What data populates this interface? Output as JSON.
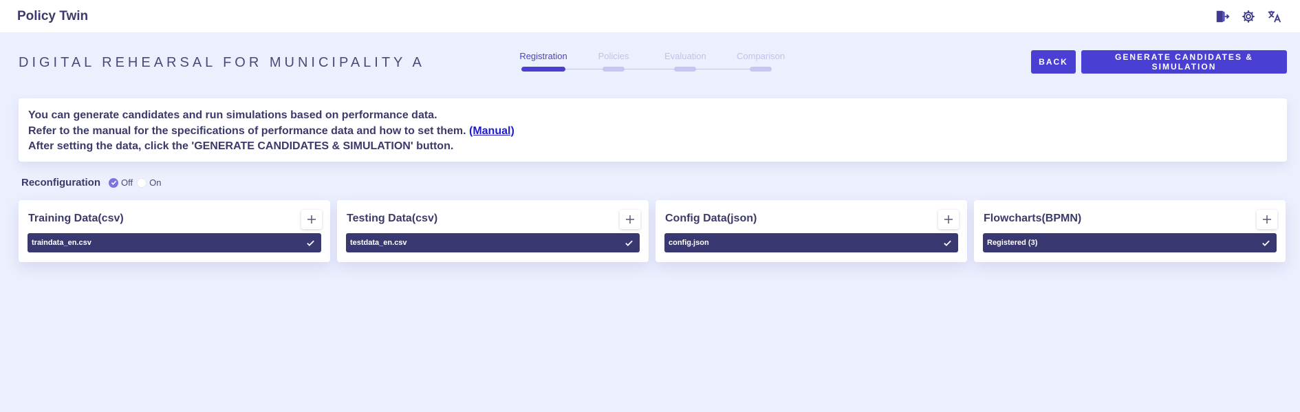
{
  "app": {
    "title": "Policy Twin"
  },
  "top_icons": [
    {
      "name": "logout-icon"
    },
    {
      "name": "gear-icon"
    },
    {
      "name": "translate-icon"
    }
  ],
  "page": {
    "title": "DIGITAL REHEARSAL FOR MUNICIPALITY A"
  },
  "stepper": {
    "steps": [
      {
        "label": "Registration",
        "active": true
      },
      {
        "label": "Policies",
        "active": false
      },
      {
        "label": "Evaluation",
        "active": false
      },
      {
        "label": "Comparison",
        "active": false
      }
    ]
  },
  "buttons": {
    "back": "BACK",
    "generate": "GENERATE CANDIDATES & SIMULATION"
  },
  "info": {
    "line1": "You can generate candidates and run simulations based on performance data.",
    "line2": "Refer to the manual for the specifications of performance data and how to set them.",
    "manual_link": "(Manual)",
    "line3": "After setting the data, click the 'GENERATE CANDIDATES & SIMULATION' button."
  },
  "reconfiguration": {
    "label": "Reconfiguration",
    "options": [
      {
        "label": "Off",
        "checked": true
      },
      {
        "label": "On",
        "checked": false
      }
    ]
  },
  "cards": [
    {
      "title": "Training Data(csv)",
      "file": "traindata_en.csv"
    },
    {
      "title": "Testing Data(csv)",
      "file": "testdata_en.csv"
    },
    {
      "title": "Config Data(json)",
      "file": "config.json"
    },
    {
      "title": "Flowcharts(BPMN)",
      "file": "Registered (3)"
    }
  ],
  "colors": {
    "accent": "#4a3fd3",
    "file_chip": "#3a3871",
    "background": "#eceffd"
  }
}
